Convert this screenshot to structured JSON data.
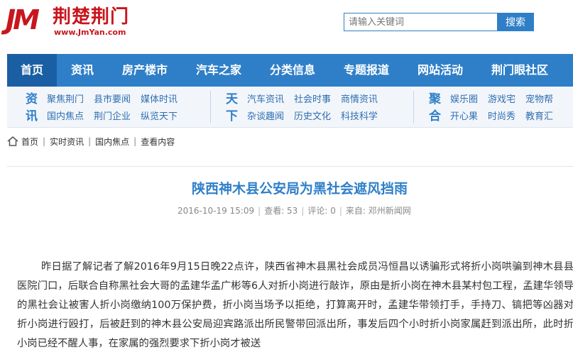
{
  "header": {
    "logo_mark": "JM",
    "logo_name": "荆楚荆门",
    "logo_url": "www.JmYan.com",
    "search_placeholder": "请输入关键词",
    "search_button": "搜索"
  },
  "nav": {
    "items": [
      "首页",
      "资讯",
      "房产楼市",
      "汽车之家",
      "分类信息",
      "专题报道",
      "网站活动",
      "荆门眼社区"
    ]
  },
  "subnav": {
    "groups": [
      {
        "title": "资讯",
        "links": [
          "聚焦荆门",
          "国内焦点",
          "县市要闻",
          "荆门企业",
          "媒体时讯",
          "纵览天下"
        ]
      },
      {
        "title": "天下",
        "links": [
          "汽车资讯",
          "杂谈趣闻",
          "社会时事",
          "历史文化",
          "商情资讯",
          "科技科学"
        ]
      },
      {
        "title": "聚合",
        "links": [
          "娱乐圈",
          "开心果",
          "游戏宅",
          "时尚秀",
          "宠物帮",
          "教育汇"
        ]
      }
    ]
  },
  "breadcrumb": {
    "items": [
      "首页",
      "实时资讯",
      "国内焦点",
      "查看内容"
    ]
  },
  "article": {
    "title": "陕西神木县公安局为黑社会遮风挡雨",
    "date": "2016-10-19 15:09",
    "views": "查看: 53",
    "comments": "评论: 0",
    "source": "来自: 邓州新闻网",
    "body": "昨日据了解记者了解2016年9月15日晚22点许，陕西省神木县黑社会成员冯恒昌以诱骗形式将折小岗哄骗到神木县县医院门口，后联合自称黑社会大哥的孟建华孟广彬等6人对折小岗进行敲诈，原由是折小岗在神木县某村包工程，孟建华领导的黑社会让被害人折小岗缴纳100万保护费，折小岗当场予以拒绝，打算离开时，孟建华带领打手，手持刀、镐把等凶器对折小岗进行殴打，后被赶到的神木县公安局迎宾路派出所民警带回派出所，事发后四个小时折小岗家属赶到派出所，此时折小岗已经不醒人事，在家属的强烈要求下折小岗才被送"
  }
}
